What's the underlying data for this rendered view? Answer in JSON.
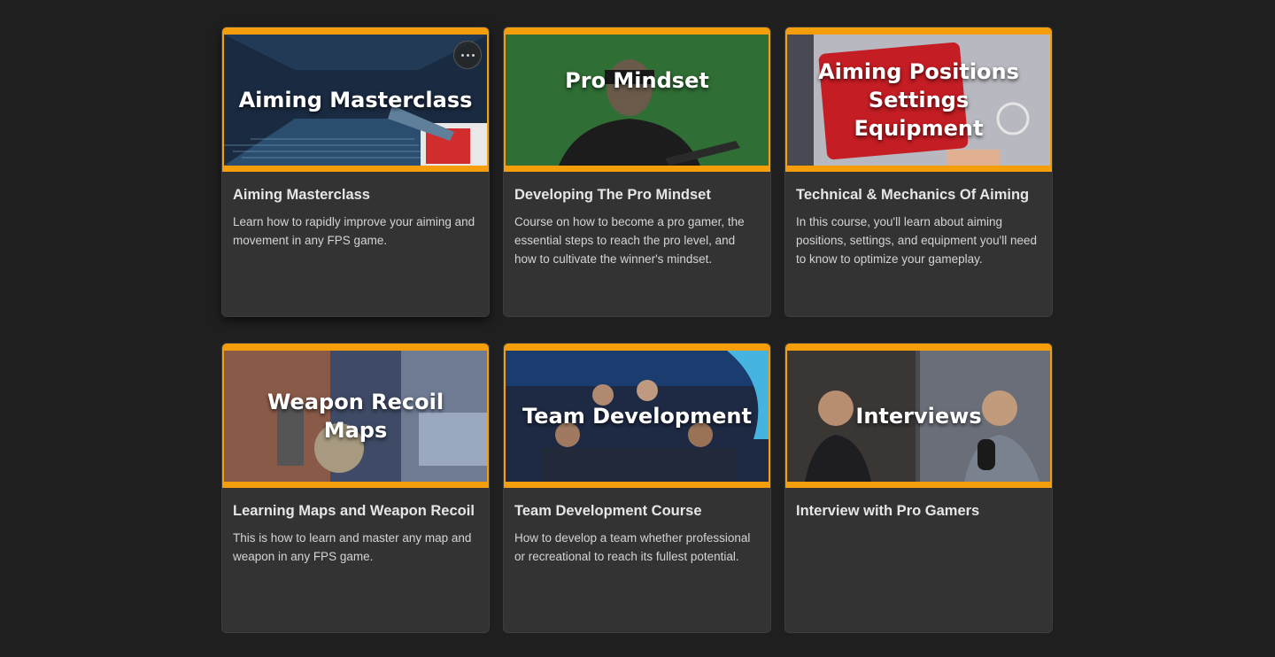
{
  "courses": [
    {
      "thumb_title": "Aiming Masterclass",
      "title": "Aiming Masterclass",
      "description": "Learn how to rapidly improve your aiming and movement in any FPS game."
    },
    {
      "thumb_title": "Pro Mindset",
      "title": "Developing The Pro Mindset",
      "description": "Course on how to become a pro gamer, the essential steps to reach the pro level, and how to cultivate the winner's mindset."
    },
    {
      "thumb_title": "Aiming Positions\nSettings\nEquipment",
      "title": "Technical & Mechanics Of Aiming",
      "description": "In this course, you'll learn about aiming positions, settings, and equipment you'll need to know to optimize your gameplay."
    },
    {
      "thumb_title": "Weapon Recoil\nMaps",
      "title": "Learning Maps and Weapon Recoil",
      "description": "This is how to learn and master any map and weapon in any FPS game."
    },
    {
      "thumb_title": "Team Development",
      "title": "Team Development Course",
      "description": "How to develop a team whether professional or recreational to reach its fullest potential."
    },
    {
      "thumb_title": "Interviews",
      "title": "Interview with Pro Gamers",
      "description": ""
    }
  ],
  "colors": {
    "accent": "#f59e0b",
    "background": "#1f1f1f",
    "card": "#333333"
  },
  "icons": {
    "more": "more-horizontal-icon"
  }
}
